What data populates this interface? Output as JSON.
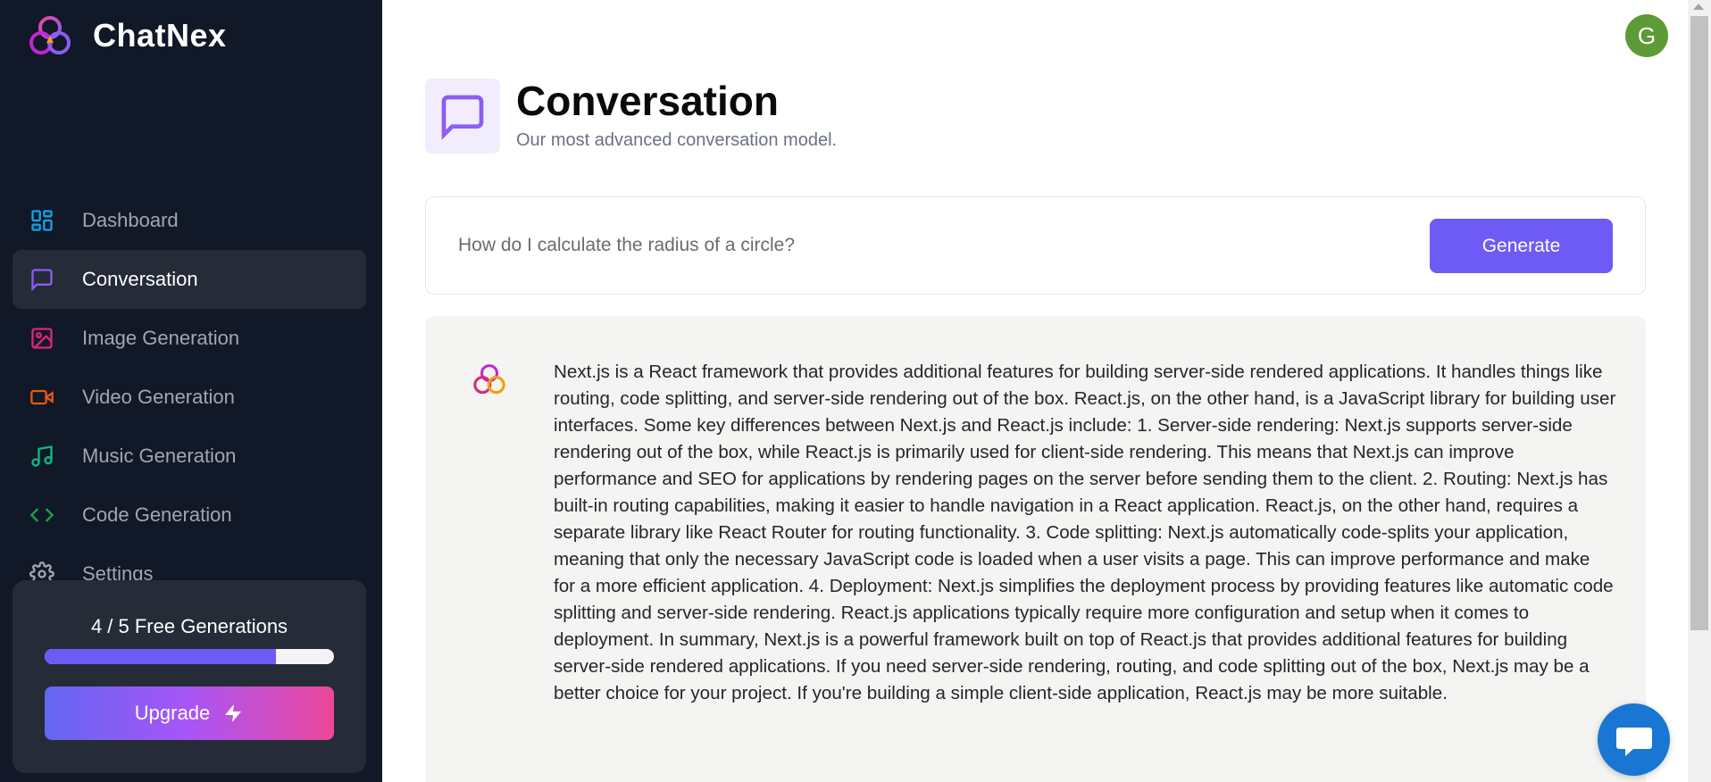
{
  "app": {
    "name": "ChatNex"
  },
  "sidebar": {
    "items": [
      {
        "label": "Dashboard",
        "icon": "layout-dashboard-icon",
        "color": "#0ea5e9"
      },
      {
        "label": "Conversation",
        "icon": "message-square-icon",
        "color": "#8b5cf6",
        "active": true
      },
      {
        "label": "Image Generation",
        "icon": "image-icon",
        "color": "#db2777"
      },
      {
        "label": "Video Generation",
        "icon": "video-icon",
        "color": "#ea580c"
      },
      {
        "label": "Music Generation",
        "icon": "music-icon",
        "color": "#10b981"
      },
      {
        "label": "Code Generation",
        "icon": "code-icon",
        "color": "#16a34a"
      },
      {
        "label": "Settings",
        "icon": "settings-gear-icon",
        "color": "#a1a6b3"
      }
    ],
    "usage": {
      "text": "4 / 5 Free Generations",
      "used": 4,
      "limit": 5
    },
    "upgrade_label": "Upgrade"
  },
  "header": {
    "avatar_initial": "G"
  },
  "page": {
    "title": "Conversation",
    "subtitle": "Our most advanced conversation model."
  },
  "prompt": {
    "placeholder": "How do I calculate the radius of a circle?",
    "value": "",
    "generate_label": "Generate"
  },
  "answer": {
    "text": "Next.js is a React framework that provides additional features for building server-side rendered applications. It handles things like routing, code splitting, and server-side rendering out of the box. React.js, on the other hand, is a JavaScript library for building user interfaces. Some key differences between Next.js and React.js include: 1. Server-side rendering: Next.js supports server-side rendering out of the box, while React.js is primarily used for client-side rendering. This means that Next.js can improve performance and SEO for applications by rendering pages on the server before sending them to the client. 2. Routing: Next.js has built-in routing capabilities, making it easier to handle navigation in a React application. React.js, on the other hand, requires a separate library like React Router for routing functionality. 3. Code splitting: Next.js automatically code-splits your application, meaning that only the necessary JavaScript code is loaded when a user visits a page. This can improve performance and make for a more efficient application. 4. Deployment: Next.js simplifies the deployment process by providing features like automatic code splitting and server-side rendering. React.js applications typically require more configuration and setup when it comes to deployment. In summary, Next.js is a powerful framework built on top of React.js that provides additional features for building server-side rendered applications. If you need server-side rendering, routing, and code splitting out of the box, Next.js may be a better choice for your project. If you're building a simple client-side application, React.js may be more suitable."
  },
  "colors": {
    "sidebar_bg": "#111827",
    "accent": "#6e5bf5",
    "avatar_bg": "#5c9b35",
    "chat_fab": "#1976d2"
  }
}
